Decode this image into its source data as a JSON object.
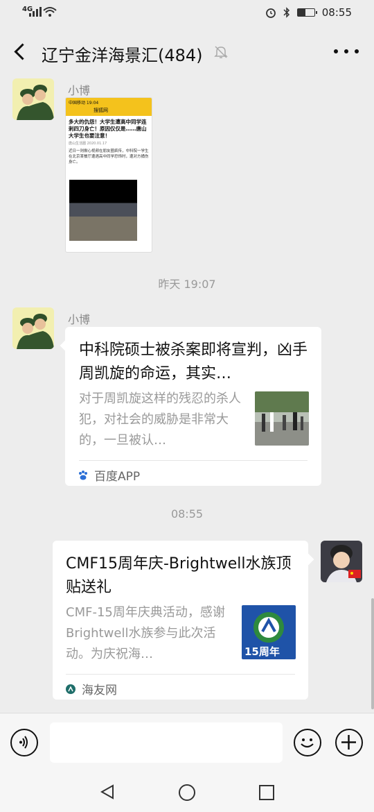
{
  "status": {
    "network": "4G",
    "time": "08:55",
    "battery_level": 0.45
  },
  "header": {
    "title": "辽宁金洋海景汇(484)"
  },
  "messages": {
    "m1": {
      "sender": "小博",
      "screenshot": {
        "statusbar": "中国移动  19:04",
        "app_title": "搜狐网",
        "headline": "多大的仇怨！大学生遭高中同学连刺四刀身亡！原因仅仅是……唐山大学生也要注意！",
        "source": "唐山生活圈 2020.01.17",
        "body": "近日一则揪心视频在朋友圈疯传，中科院一学生在北京某餐厅遭遇高中同学恐饰时，遭对方捅伤身亡。"
      }
    },
    "time1": "昨天 19:07",
    "m2": {
      "sender": "小博",
      "title": "中科院硕士被杀案即将宣判，凶手周凯旋的命运，其实…",
      "desc": "对于周凯旋这样的残忍的杀人犯，对社会的威胁是非常大的，一旦被认…",
      "source": "百度APP"
    },
    "time2": "08:55",
    "m3": {
      "title": "CMF15周年庆-Brightwell水族顶贴送礼",
      "desc": "CMF-15周年庆典活动，感谢Brightwell水族参与此次活动。为庆祝海…",
      "source": "海友网",
      "thumb_text": "15周年"
    }
  },
  "colors": {
    "background": "#ededed",
    "card": "#ffffff",
    "muted": "#999999"
  }
}
